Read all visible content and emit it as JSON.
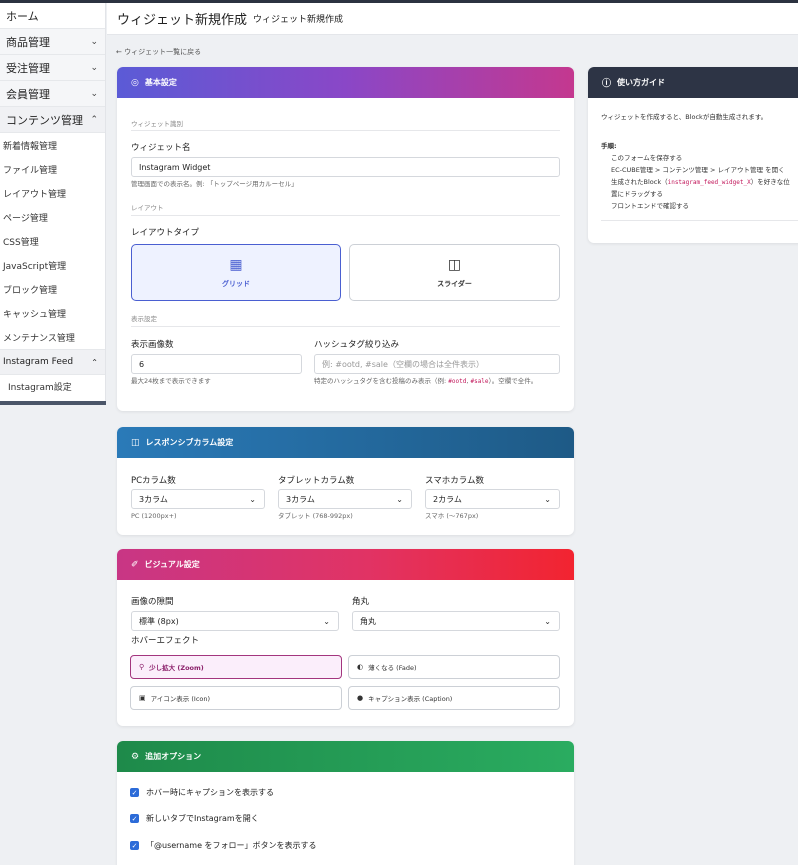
{
  "sidebar": {
    "home": "ホーム",
    "menus": [
      {
        "label": "商品管理"
      },
      {
        "label": "受注管理"
      },
      {
        "label": "会員管理"
      },
      {
        "label": "コンテンツ管理"
      }
    ],
    "content_items": [
      "新着情報管理",
      "ファイル管理",
      "レイアウト管理",
      "ページ管理",
      "CSS管理",
      "JavaScript管理",
      "ブロック管理",
      "キャッシュ管理",
      "メンテナンス管理"
    ],
    "feed": "Instagram Feed",
    "feed_sub": "Instagram設定"
  },
  "header": {
    "title": "ウィジェット新規作成",
    "subtitle": "ウィジェット新規作成"
  },
  "back_link": "← ウィジェット一覧に戻る",
  "basic": {
    "heading": "基本設定",
    "section_id": "ウィジェット識別",
    "name_label": "ウィジェット名",
    "name_value": "Instagram Widget",
    "name_help": "管理画面での表示名。例: 「トップページ用カルーセル」",
    "section_layout": "レイアウト",
    "layout_label": "レイアウトタイプ",
    "layout_grid": "グリッド",
    "layout_slider": "スライダー",
    "section_display": "表示設定",
    "count_label": "表示画像数",
    "count_value": "6",
    "count_help": "最大24枚まで表示できます",
    "hashtag_label": "ハッシュタグ絞り込み",
    "hashtag_placeholder": "例: #ootd, #sale（空欄の場合は全件表示）",
    "hashtag_help_1": "特定のハッシュタグを含む投稿のみ表示（例: ",
    "hashtag_code_1": "#ootd",
    "hashtag_sep": ", ",
    "hashtag_code_2": "#sale",
    "hashtag_help_2": "）。空欄で全件。"
  },
  "responsive": {
    "heading": "レスポンシブカラム設定",
    "pc_label": "PCカラム数",
    "pc_value": "3カラム",
    "pc_help": "PC (1200px+)",
    "tablet_label": "タブレットカラム数",
    "tablet_value": "3カラム",
    "tablet_help": "タブレット (768-992px)",
    "sp_label": "スマホカラム数",
    "sp_value": "2カラム",
    "sp_help": "スマホ (〜767px)"
  },
  "visual": {
    "heading": "ビジュアル設定",
    "gap_label": "画像の隙間",
    "gap_value": "標準 (8px)",
    "radius_label": "角丸",
    "radius_value": "角丸",
    "hover_label": "ホバーエフェクト",
    "hover_zoom": "少し拡大 (Zoom)",
    "hover_fade": "薄くなる (Fade)",
    "hover_icon": "アイコン表示 (Icon)",
    "hover_caption": "キャプション表示 (Caption)"
  },
  "options": {
    "heading": "追加オプション",
    "opt1": "ホバー時にキャプションを表示する",
    "opt2": "新しいタブでInstagramを開く",
    "opt3": "「@username をフォロー」ボタンを表示する"
  },
  "guide": {
    "heading": "使い方ガイド",
    "intro": "ウィジェットを作成すると、Blockが自動生成されます。",
    "steps_title": "手順:",
    "step1": "このフォームを保存する",
    "step2": "EC-CUBE管理 > コンテンツ管理 > レイアウト管理 を開く",
    "step3a": "生成されたBlock（",
    "step3code": "instagram_feed_widget_X",
    "step3b": "）を好きな位",
    "step3c": "置にドラッグする",
    "step4": "フロントエンドで確認する"
  },
  "colors": {
    "accent": "#4a5fd1",
    "checkbox": "#2c6bd8",
    "zoom_selected": "#a3357e"
  }
}
